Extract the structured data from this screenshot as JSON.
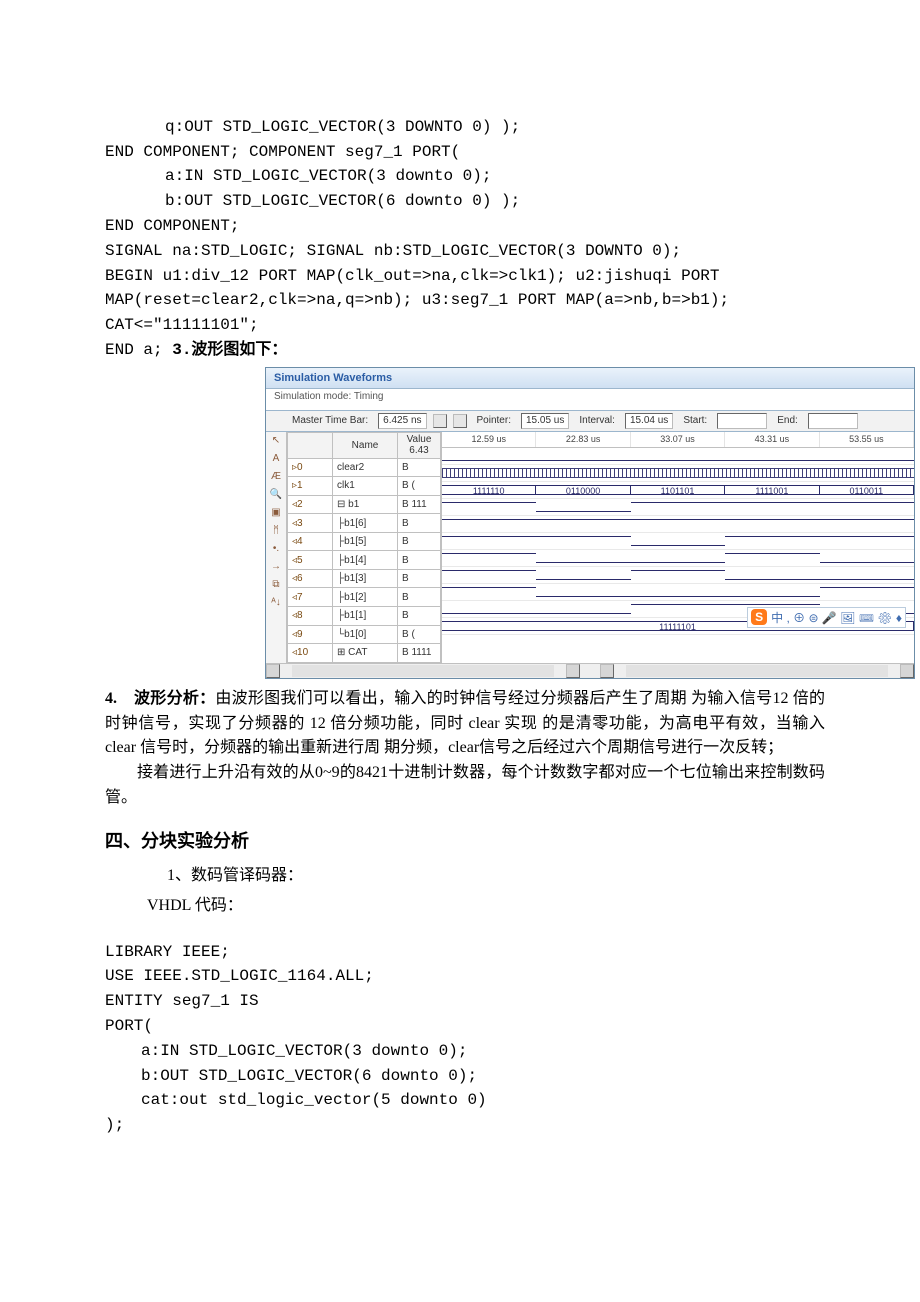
{
  "code_top": {
    "l1": "q:OUT STD_LOGIC_VECTOR(3 DOWNTO 0) );",
    "l2": "END COMPONENT; COMPONENT seg7_1 PORT(",
    "l3": "a:IN STD_LOGIC_VECTOR(3 downto 0);",
    "l4": "b:OUT STD_LOGIC_VECTOR(6 downto 0) );",
    "l5": "END COMPONENT;",
    "l6": "SIGNAL na:STD_LOGIC; SIGNAL nb:STD_LOGIC_VECTOR(3 DOWNTO 0);",
    "l7": "BEGIN u1:div_12 PORT MAP(clk_out=>na,clk=>clk1); u2:jishuqi PORT",
    "l8": "MAP(reset=clear2,clk=>na,q=>nb); u3:seg7_1 PORT MAP(a=>nb,b=>b1);",
    "l9": "CAT<=\"11111101\";",
    "l10a": "END a; ",
    "l10b": "3.波形图如下："
  },
  "sim": {
    "title": "Simulation Waveforms",
    "subtitle": "Simulation mode: Timing",
    "toolbar": {
      "master_label": "Master Time Bar:",
      "master_value": "6.425 ns",
      "pointer_label": "Pointer:",
      "pointer_value": "15.05 us",
      "interval_label": "Interval:",
      "interval_value": "15.04 us",
      "start_label": "Start:",
      "end_label": "End:"
    },
    "headers": {
      "name": "Name",
      "value": "Value\n6.43"
    },
    "time_ticks": [
      "12.59 us",
      "22.83 us",
      "33.07 us",
      "43.31 us",
      "53.55 us"
    ],
    "signals": [
      {
        "idx": "0",
        "name": "clear2",
        "val": "B"
      },
      {
        "idx": "1",
        "name": "clk1",
        "val": "B ("
      },
      {
        "idx": "2",
        "name": "b1",
        "val": "B 111",
        "expand": true
      },
      {
        "idx": "3",
        "name": "b1[6]",
        "val": "B"
      },
      {
        "idx": "4",
        "name": "b1[5]",
        "val": "B"
      },
      {
        "idx": "5",
        "name": "b1[4]",
        "val": "B"
      },
      {
        "idx": "6",
        "name": "b1[3]",
        "val": "B"
      },
      {
        "idx": "7",
        "name": "b1[2]",
        "val": "B"
      },
      {
        "idx": "8",
        "name": "b1[1]",
        "val": "B"
      },
      {
        "idx": "9",
        "name": "b1[0]",
        "val": "B ("
      },
      {
        "idx": "10",
        "name": "CAT",
        "val": "B 1111",
        "expand": true
      }
    ],
    "bus_b1": [
      "1111110",
      "0110000",
      "1101101",
      "1111001",
      "0110011"
    ],
    "bus_cat_center": "11111101",
    "floating": "中 , ⊕ ⊜ 🎤 🖼 ⌨ ⚙ ♦"
  },
  "analysis": {
    "heading_num": "4.",
    "heading": "波形分析：",
    "p1": "由波形图我们可以看出，输入的时钟信号经过分频器后产生了周期 为输入信号12 倍的时钟信号，实现了分频器的 12 倍分频功能，同时 clear 实现 的是清零功能，为高电平有效，当输入 clear 信号时，分频器的输出重新进行周 期分频，clear信号之后经过六个周期信号进行一次反转；",
    "p2_indent": "接着进行上升沿有效的从0~9的8421十进制计数器，每个计数数字都对应一个七位输出来控制数码管。"
  },
  "section4": {
    "title": "四、分块实验分析",
    "sub1": "1、数码管译码器：",
    "vlabel": "VHDL 代码：",
    "code": {
      "l1": "LIBRARY IEEE;",
      "l2": "USE IEEE.STD_LOGIC_1164.ALL;",
      "l3": "ENTITY seg7_1 IS",
      "l4": "PORT(",
      "l5": "a:IN STD_LOGIC_VECTOR(3 downto 0);",
      "l6": "b:OUT STD_LOGIC_VECTOR(6 downto 0);",
      "l7": "cat:out std_logic_vector(5 downto 0)",
      "l8": ");"
    }
  }
}
